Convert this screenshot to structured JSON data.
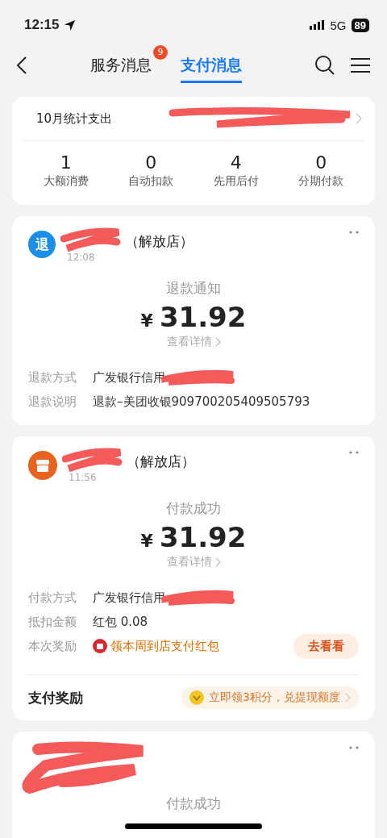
{
  "status_bar": {
    "time": "12:15",
    "network": "5G",
    "battery": "89"
  },
  "nav": {
    "tabs": [
      {
        "label": "服务消息",
        "selected": false,
        "badge": "9"
      },
      {
        "label": "支付消息",
        "selected": true
      }
    ]
  },
  "summary": {
    "title": "10月统计支出",
    "stats": [
      {
        "value": "1",
        "label": "大额消费"
      },
      {
        "value": "0",
        "label": "自动扣款"
      },
      {
        "value": "4",
        "label": "先用后付"
      },
      {
        "value": "0",
        "label": "分期付款"
      }
    ]
  },
  "cards": [
    {
      "kind": "refund",
      "icon_text": "退",
      "merchant": "（解放店）",
      "time": "12:08",
      "title": "退款通知",
      "currency": "¥",
      "amount": "31.92",
      "link": "查看详情",
      "rows": [
        {
          "kind": "redacted",
          "label": "退款方式",
          "value": "广发银行信用"
        },
        {
          "kind": "text",
          "label": "退款说明",
          "value": "退款–美团收银909700205409505793"
        }
      ]
    },
    {
      "kind": "payment",
      "merchant": "（解放店）",
      "time": "11:56",
      "title": "付款成功",
      "currency": "¥",
      "amount": "31.92",
      "link": "查看详情",
      "rows": [
        {
          "kind": "redacted",
          "label": "付款方式",
          "value": "广发银行信用"
        },
        {
          "kind": "text",
          "label": "抵扣金额",
          "value": "红包 0.08"
        },
        {
          "kind": "reward",
          "label": "本次奖励",
          "value": "领本周到店支付红包",
          "button": "去看看"
        }
      ],
      "footer": {
        "label": "支付奖励",
        "promo": "立即领3积分，兑提现额度"
      }
    },
    {
      "kind": "payment_partial",
      "title": "付款成功"
    }
  ]
}
